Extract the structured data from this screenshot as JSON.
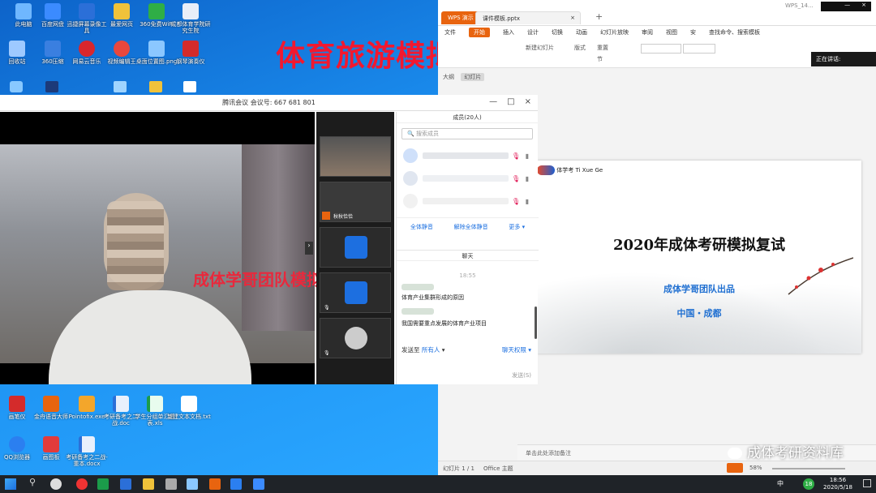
{
  "headline": "体育旅游模拟复试",
  "desktop": {
    "icons": [
      {
        "label": "此电脑",
        "color": "#6fb7ff"
      },
      {
        "label": "百度网盘",
        "color": "#3b8bff"
      },
      {
        "label": "迅捷屏幕录像工具",
        "color": "#2b6fd8"
      },
      {
        "label": "最爱网页",
        "color": "#f0c23a"
      },
      {
        "label": "360免费WiFi",
        "color": "#2fae46"
      },
      {
        "label": "成都体育学院研究生院",
        "color": "#e8eef8"
      },
      {
        "label": "回收站",
        "color": "#9ec9ff"
      },
      {
        "label": "360压缩",
        "color": "#3a7fe0"
      },
      {
        "label": "网易云音乐",
        "color": "#d8262d"
      },
      {
        "label": "视频编辑王",
        "color": "#e9473d"
      },
      {
        "label": "桌面位置图.png",
        "color": "#8bc7ff"
      },
      {
        "label": "钢琴演奏仪",
        "color": "#d42b2b"
      },
      {
        "label": "画笔仪",
        "color": "#d42b2b"
      },
      {
        "label": "金舟语音大师",
        "color": "#e8640f"
      },
      {
        "label": "Pointofix.exe",
        "color": "#f3a62b"
      },
      {
        "label": "考研备考之二战.doc",
        "color": "#2b6fd8"
      },
      {
        "label": "学生分组单汇总表.xls",
        "color": "#1b9b4a"
      },
      {
        "label": "新建文本文档.txt",
        "color": "#ffffff"
      },
      {
        "label": "QQ浏览器",
        "color": "#2b7ff0"
      },
      {
        "label": "画图板",
        "color": "#e33b3b"
      },
      {
        "label": "考研备考之二战-重本.docx",
        "color": "#2b6fd8"
      }
    ]
  },
  "meeting": {
    "title": "腾讯会议 会议号: 667 681 801",
    "overlay_text": "成体学哥团队模拟复试",
    "thumb_name": "秋秋恰恰",
    "members": {
      "header": "成员(20人)",
      "search_placeholder": "搜索成员",
      "mute_all": "全体静音",
      "unmute_all": "解除全体静音",
      "more": "更多"
    },
    "chat": {
      "header": "聊天",
      "time": "18:55",
      "messages": [
        "体育产业集群形成的原因",
        "我国需要重点发展的体育产业项目"
      ],
      "send_to_label": "发送至",
      "send_to_value": "所有人",
      "permission": "聊天权限",
      "send": "发送(S)"
    }
  },
  "wps": {
    "window_title": "WPS_14...",
    "tabs": [
      "WPS 演示",
      "课件模板.pptx"
    ],
    "menu": [
      "文件",
      "开始",
      "插入",
      "设计",
      "切换",
      "动画",
      "幻灯片放映",
      "审阅",
      "视图",
      "安",
      "查找命令、搜索模板"
    ],
    "ribbon": [
      "新建幻灯片",
      "版式",
      "节",
      "重置"
    ],
    "presenting": "正在讲话:",
    "side_tabs": [
      "大纲",
      "幻灯片"
    ],
    "slide": {
      "logo": "体学考 Ti Xue Ge",
      "title": "2020年成体考研模拟复试",
      "sub1": "成体学哥团队出品",
      "sub2": "中国・成都"
    },
    "notes": "单击此处添加备注",
    "status": {
      "slide_count": "幻灯片 1 / 1",
      "theme": "Office 主题",
      "zoom": "58%"
    },
    "watermark": "成体考研资料库"
  },
  "taskbar": {
    "time": "18:56",
    "date": "2020/5/18",
    "lang": "中",
    "badge": "18"
  }
}
